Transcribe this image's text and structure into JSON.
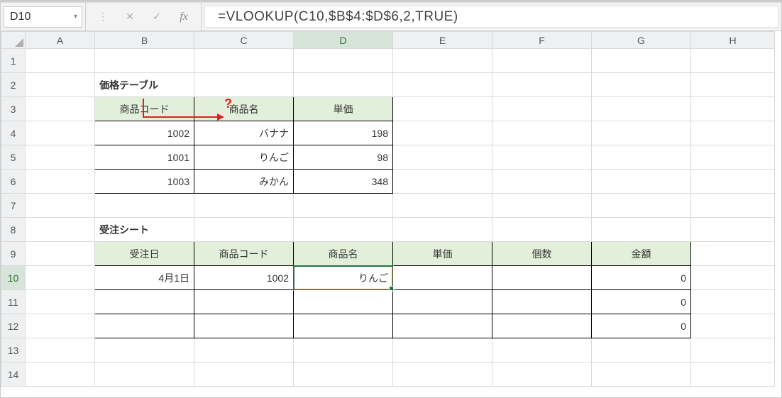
{
  "namebox": {
    "value": "D10"
  },
  "formula_bar": {
    "text": "=VLOOKUP(C10,$B$4:$D$6,2,TRUE)"
  },
  "icons": {
    "dots": "⋮",
    "cancel": "✕",
    "enter": "✓",
    "fx": "fx",
    "caret": "▾"
  },
  "columns": [
    "A",
    "B",
    "C",
    "D",
    "E",
    "F",
    "G",
    "H"
  ],
  "rows": [
    "1",
    "2",
    "3",
    "4",
    "5",
    "6",
    "7",
    "8",
    "9",
    "10",
    "11",
    "12",
    "13",
    "14"
  ],
  "selected": {
    "col": "D",
    "row": "10"
  },
  "annotations": {
    "question_mark": "?"
  },
  "labels": {
    "price_table_title": "価格テーブル",
    "order_sheet_title": "受注シート"
  },
  "price_table": {
    "headers": {
      "code": "商品コード",
      "name": "商品名",
      "unit_price": "単価"
    },
    "rows": [
      {
        "code": "1002",
        "name": "バナナ",
        "price": "198"
      },
      {
        "code": "1001",
        "name": "りんご",
        "price": "98"
      },
      {
        "code": "1003",
        "name": "みかん",
        "price": "348"
      }
    ]
  },
  "order_sheet": {
    "headers": {
      "date": "受注日",
      "code": "商品コード",
      "name": "商品名",
      "unit_price": "単価",
      "qty": "個数",
      "amount": "金額"
    },
    "rows": [
      {
        "date": "4月1日",
        "code": "1002",
        "name": "りんご",
        "unit_price": "",
        "qty": "",
        "amount": "0"
      },
      {
        "date": "",
        "code": "",
        "name": "",
        "unit_price": "",
        "qty": "",
        "amount": "0"
      },
      {
        "date": "",
        "code": "",
        "name": "",
        "unit_price": "",
        "qty": "",
        "amount": "0"
      }
    ]
  }
}
